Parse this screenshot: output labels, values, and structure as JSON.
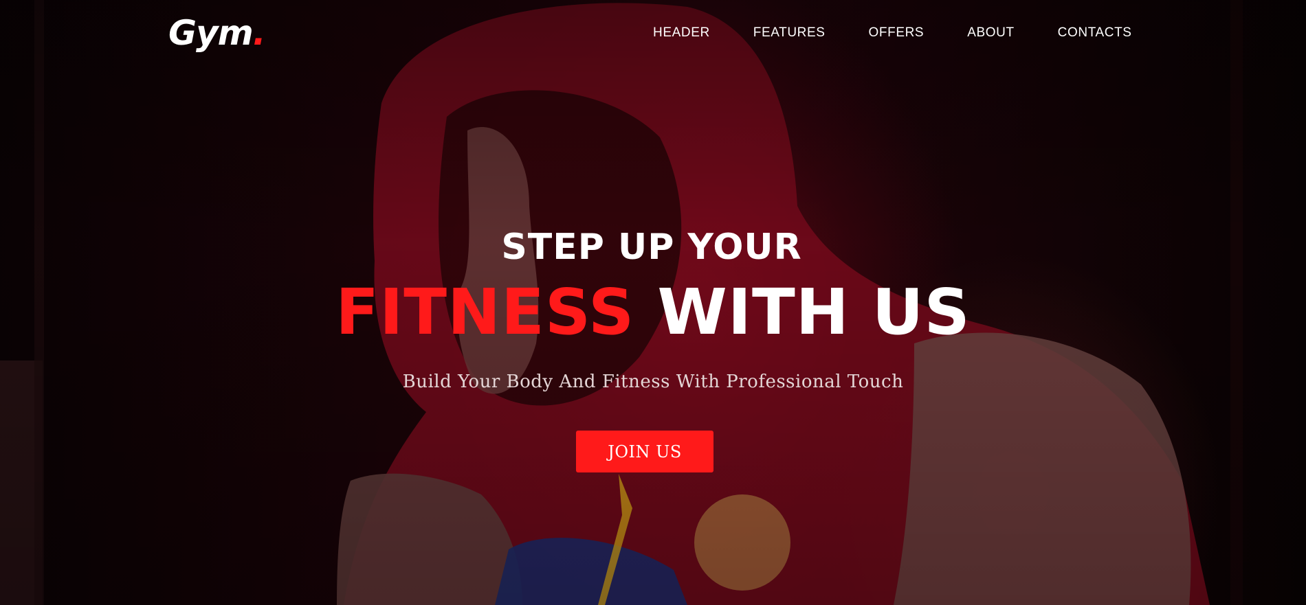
{
  "brand": {
    "name": "Gym",
    "dot": "."
  },
  "nav": {
    "items": [
      "HEADER",
      "FEATURES",
      "OFFERS",
      "ABOUT",
      "CONTACTS"
    ]
  },
  "hero": {
    "line1": "STEP UP YOUR",
    "accent_word": "FITNESS",
    "rest_word": "WITH US",
    "subtitle": "Build Your Body And Fitness With Professional Touch",
    "cta_label": "JOIN US",
    "background_image": "hooded-boxer-photo"
  },
  "colors": {
    "accent": "#ff1a1a",
    "text": "#ffffff",
    "background": "#1a0307"
  }
}
